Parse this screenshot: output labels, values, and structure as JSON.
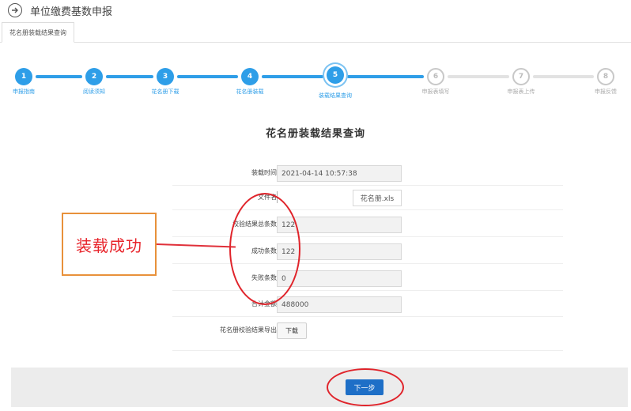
{
  "header": {
    "title": "单位缴费基数申报",
    "icon": "circle-arrow-right-icon"
  },
  "tabs": [
    {
      "label": "花名册装载结果查询"
    }
  ],
  "steps": [
    {
      "num": "1",
      "label": "申报指南",
      "state": "done"
    },
    {
      "num": "2",
      "label": "阅读须知",
      "state": "done"
    },
    {
      "num": "3",
      "label": "花名册下载",
      "state": "done"
    },
    {
      "num": "4",
      "label": "花名册装载",
      "state": "done"
    },
    {
      "num": "5",
      "label": "装载结果查询",
      "state": "current"
    },
    {
      "num": "6",
      "label": "申报表填写",
      "state": "todo"
    },
    {
      "num": "7",
      "label": "申报表上传",
      "state": "todo"
    },
    {
      "num": "8",
      "label": "申报反馈",
      "state": "todo"
    }
  ],
  "form": {
    "title": "花名册装载结果查询",
    "load_time_label": "装载时间",
    "load_time_value": "2021-04-14 10:57:38",
    "file_name_label": "文件名",
    "file_name_value": "花名册.xls",
    "total_label": "校验结果总条数",
    "total_value": "122",
    "success_label": "成功条数",
    "success_value": "122",
    "fail_label": "失败条数",
    "fail_value": "0",
    "amount_label": "合计金额",
    "amount_value": "488000",
    "export_label": "花名册校验结果导出",
    "download_button": "下载"
  },
  "annotation": {
    "text": "装载成功",
    "box_color": "#e8913a",
    "text_color": "#e8242b"
  },
  "footer": {
    "next_button": "下一步"
  },
  "colors": {
    "accent": "#2e9ee8",
    "primary_button": "#1e6fc7",
    "annotation_red": "#e0242b"
  }
}
